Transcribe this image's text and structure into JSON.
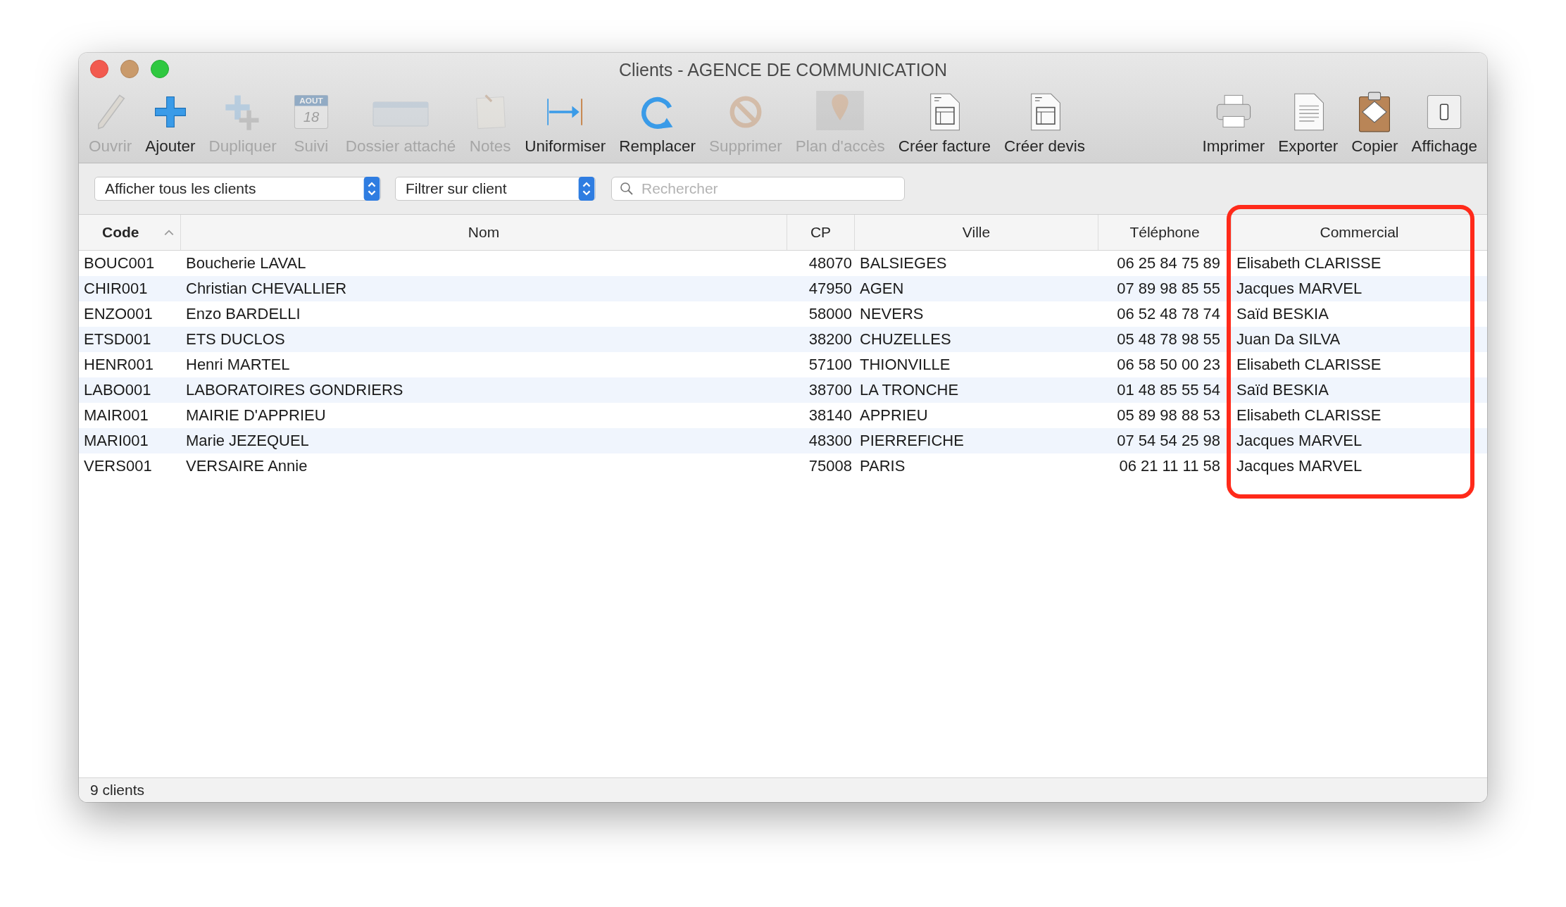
{
  "window": {
    "title": "Clients - AGENCE DE COMMUNICATION"
  },
  "toolbar": {
    "left": [
      {
        "label": "Ouvrir",
        "enabled": false,
        "kind": "pencil"
      },
      {
        "label": "Ajouter",
        "enabled": true,
        "kind": "plus"
      },
      {
        "label": "Dupliquer",
        "enabled": false,
        "kind": "duplicate"
      },
      {
        "label": "Suivi",
        "enabled": false,
        "kind": "calendar",
        "month": "AOUT",
        "day": "18"
      },
      {
        "label": "Dossier attaché",
        "enabled": false,
        "kind": "folder"
      },
      {
        "label": "Notes",
        "enabled": false,
        "kind": "note"
      },
      {
        "label": "Uniformiser",
        "enabled": true,
        "kind": "arrow"
      },
      {
        "label": "Remplacer",
        "enabled": true,
        "kind": "refresh"
      },
      {
        "label": "Supprimer",
        "enabled": false,
        "kind": "forbidden"
      },
      {
        "label": "Plan d'accès",
        "enabled": false,
        "kind": "pin"
      },
      {
        "label": "Créer facture",
        "enabled": true,
        "kind": "document"
      },
      {
        "label": "Créer devis",
        "enabled": true,
        "kind": "document"
      }
    ],
    "right": [
      {
        "label": "Imprimer",
        "enabled": true,
        "kind": "printer"
      },
      {
        "label": "Exporter",
        "enabled": true,
        "kind": "page"
      },
      {
        "label": "Copier",
        "enabled": true,
        "kind": "clipboard"
      },
      {
        "label": "Affichage",
        "enabled": true,
        "kind": "switch"
      }
    ]
  },
  "filters": {
    "show_select": "Afficher tous les clients",
    "filter_select": "Filtrer sur client",
    "search": {
      "placeholder": "Rechercher"
    }
  },
  "table": {
    "columns": [
      {
        "label": "Code",
        "sorted": true
      },
      {
        "label": "Nom",
        "sorted": false
      },
      {
        "label": "CP",
        "sorted": false
      },
      {
        "label": "Ville",
        "sorted": false
      },
      {
        "label": "Téléphone",
        "sorted": false
      },
      {
        "label": "Commercial",
        "sorted": false
      }
    ],
    "rows": [
      [
        "BOUC001",
        "Boucherie LAVAL",
        "48070",
        "BALSIEGES",
        "06 25 84 75 89",
        "Elisabeth CLARISSE"
      ],
      [
        "CHIR001",
        "Christian CHEVALLIER",
        "47950",
        "AGEN",
        "07 89 98 85 55",
        "Jacques MARVEL"
      ],
      [
        "ENZO001",
        "Enzo BARDELLI",
        "58000",
        "NEVERS",
        "06 52 48 78 74",
        "Saïd BESKIA"
      ],
      [
        "ETSD001",
        "ETS DUCLOS",
        "38200",
        "CHUZELLES",
        "05 48 78 98 55",
        "Juan Da SILVA"
      ],
      [
        "HENR001",
        "Henri MARTEL",
        "57100",
        "THIONVILLE",
        "06 58 50 00 23",
        "Elisabeth CLARISSE"
      ],
      [
        "LABO001",
        "LABORATOIRES GONDRIERS",
        "38700",
        "LA TRONCHE",
        "01 48 85 55 54",
        "Saïd BESKIA"
      ],
      [
        "MAIR001",
        "MAIRIE D'APPRIEU",
        "38140",
        "APPRIEU",
        "05 89 98 88 53",
        "Elisabeth CLARISSE"
      ],
      [
        "MARI001",
        "Marie JEZEQUEL",
        "48300",
        "PIERREFICHE",
        "07 54 54 25 98",
        "Jacques MARVEL"
      ],
      [
        "VERS001",
        "VERSAIRE Annie",
        "75008",
        "PARIS",
        "06 21 11 11 58",
        "Jacques MARVEL"
      ]
    ]
  },
  "status_bar": "9 clients"
}
